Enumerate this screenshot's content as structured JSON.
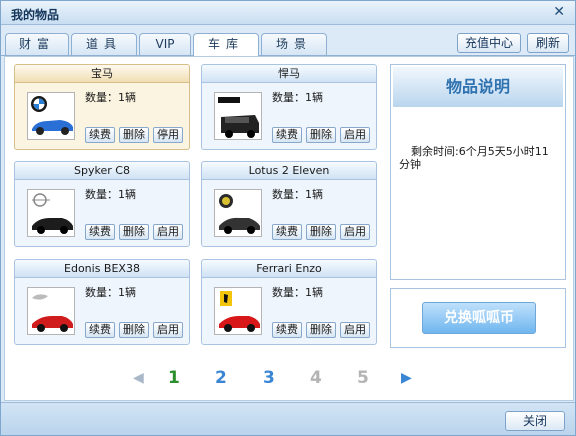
{
  "window": {
    "title": "我的物品",
    "close_symbol": "✕"
  },
  "tabs": [
    {
      "label": "财富"
    },
    {
      "label": "道具"
    },
    {
      "label": "VIP"
    },
    {
      "label": "车库",
      "active": true
    },
    {
      "label": "场景"
    }
  ],
  "topbar": {
    "recharge_label": "充值中心",
    "refresh_label": "刷新"
  },
  "cards": [
    {
      "name": "宝马",
      "qty": "数量：1辆",
      "btn1": "续费",
      "btn2": "删除",
      "btn3": "停用",
      "selected": true,
      "logo": "bmw-logo",
      "car_color": "#2a6fd6"
    },
    {
      "name": "悍马",
      "qty": "数量：1辆",
      "btn1": "续费",
      "btn2": "删除",
      "btn3": "启用",
      "logo": "hummer-logo",
      "car_color": "#222222"
    },
    {
      "name": "Spyker C8",
      "qty": "数量：1辆",
      "btn1": "续费",
      "btn2": "删除",
      "btn3": "启用",
      "logo": "spyker-logo",
      "car_color": "#1c1c1c"
    },
    {
      "name": "Lotus 2 Eleven",
      "qty": "数量：1辆",
      "btn1": "续费",
      "btn2": "删除",
      "btn3": "启用",
      "logo": "lotus-logo",
      "car_color": "#333333"
    },
    {
      "name": "Edonis BEX38",
      "qty": "数量：1辆",
      "btn1": "续费",
      "btn2": "删除",
      "btn3": "启用",
      "logo": "edonis-logo",
      "car_color": "#d01c1c"
    },
    {
      "name": "Ferrari Enzo",
      "qty": "数量：1辆",
      "btn1": "续费",
      "btn2": "删除",
      "btn3": "启用",
      "logo": "ferrari-logo",
      "car_color": "#d81818"
    }
  ],
  "description": {
    "title": "物品说明",
    "text": "剩余时间:6个月5天5小时11分钟"
  },
  "exchange": {
    "label": "兑换呱呱币"
  },
  "pagination": {
    "prev_icon": "◀",
    "next_icon": "▶",
    "pages": [
      {
        "label": "1",
        "color": "#2c8f2c"
      },
      {
        "label": "2",
        "color": "#3a86d4"
      },
      {
        "label": "3",
        "color": "#3a86d4"
      },
      {
        "label": "4",
        "color": "#b4b4b4"
      },
      {
        "label": "5",
        "color": "#b4b4b4"
      }
    ]
  },
  "footer": {
    "close_label": "关闭"
  }
}
